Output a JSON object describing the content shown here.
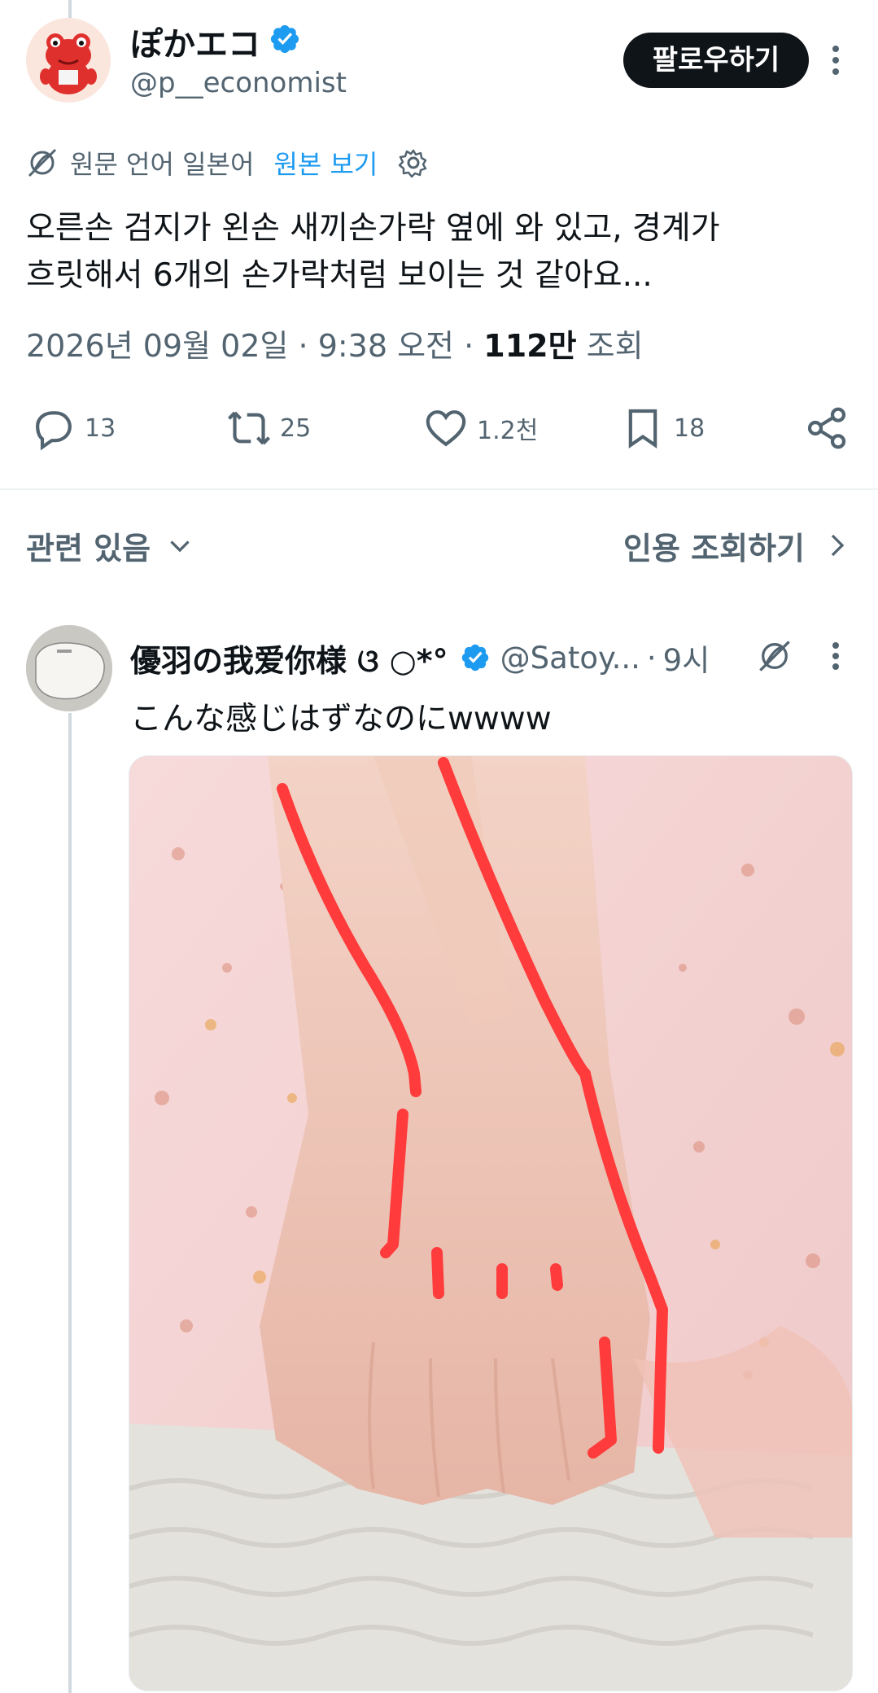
{
  "author": {
    "display_name": "ぽかエコ",
    "handle": "@p__economist",
    "follow_label": "팔로우하기"
  },
  "translation": {
    "source_label": "원문 언어 일본어",
    "show_original_label": "원본 보기"
  },
  "tweet": {
    "text_line1": "오른손 검지가 왼손 새끼손가락 옆에 와 있고, 경계가",
    "text_line2": "흐릿해서 6개의 손가락처럼 보이는 것 같아요...",
    "timestamp": "2026년 09월 02일 · 9:38 오전 · ",
    "views_count": "112만",
    "views_label": " 조회"
  },
  "actions": {
    "replies": "13",
    "reposts": "25",
    "likes": "1.2천",
    "bookmarks": "18"
  },
  "related": {
    "label": "관련 있음",
    "quotes_label": "인용 조회하기"
  },
  "reply": {
    "display_name": "優羽の我爱你様 ଓ ○*°",
    "handle": "@Satoy...",
    "separator": "·",
    "time": "9시",
    "text": "こんな感じはずなのにwwww"
  },
  "colors": {
    "accent": "#1d9bf0",
    "text": "#0f1419",
    "secondary": "#536471",
    "marker": "#ff3b3b"
  }
}
